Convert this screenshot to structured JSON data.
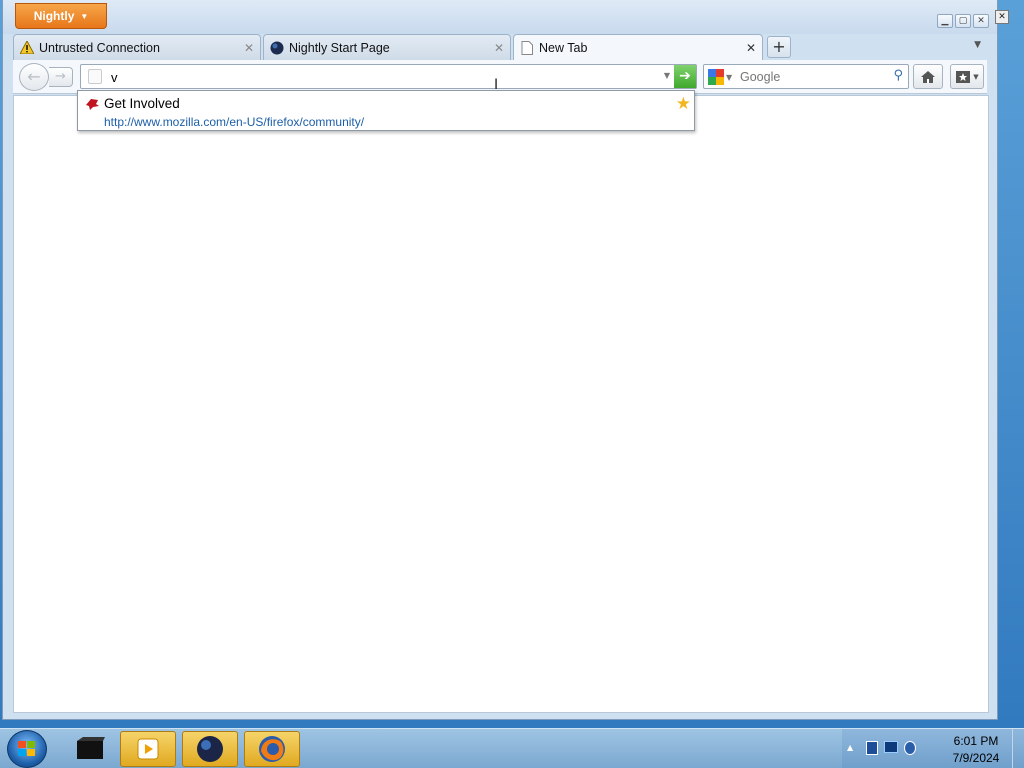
{
  "browser": {
    "app_button_label": "Nightly",
    "tabs": [
      {
        "label": "Untrusted Connection",
        "icon": "warning-icon"
      },
      {
        "label": "Nightly Start Page",
        "icon": "nightly-globe-icon"
      },
      {
        "label": "New Tab",
        "icon": "blank-page-icon",
        "active": true
      }
    ],
    "new_tab_label": "+",
    "url_value": "v",
    "search_engine": "Google",
    "search_placeholder": "Google"
  },
  "autocomplete": {
    "title": "Get Involved",
    "url": "http://www.mozilla.com/en-US/firefox/community/",
    "starred": true
  },
  "taskbar": {
    "time": "6:01 PM",
    "date": "7/9/2024",
    "pinned": [
      "terminal-icon",
      "media-player-icon",
      "globe-app-icon",
      "firefox-icon"
    ]
  },
  "colors": {
    "accent_orange": "#e7761a",
    "go_green": "#3fa82e",
    "link_blue": "#1c5fa8",
    "taskbar_blue": "#7ba8d0"
  }
}
